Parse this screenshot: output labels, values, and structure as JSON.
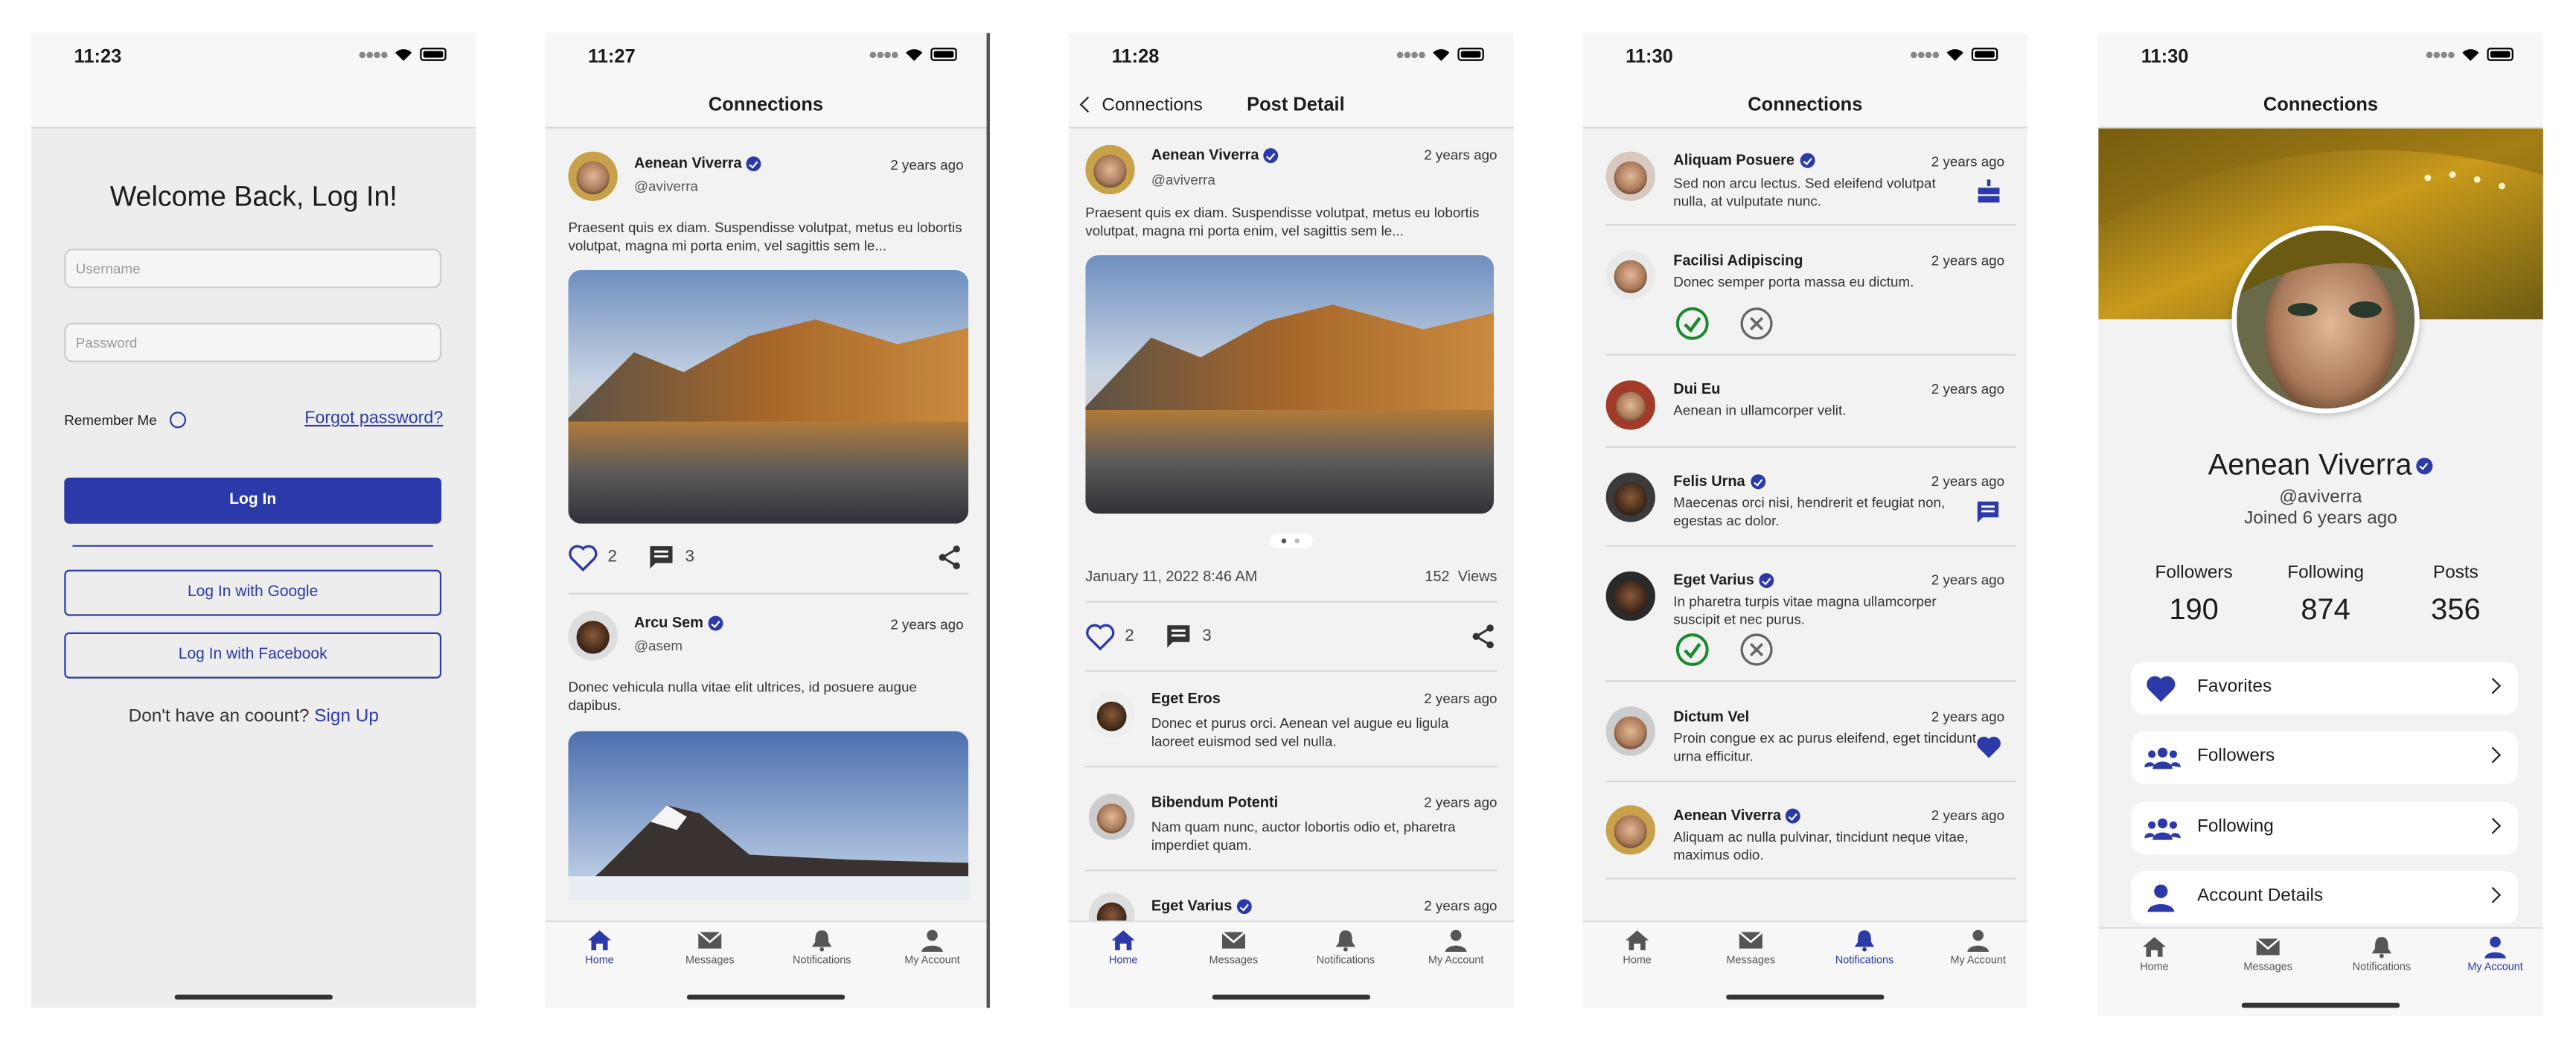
{
  "status_times": [
    "11:23",
    "11:27",
    "11:28",
    "11:30",
    "11:30"
  ],
  "tabs": [
    "Home",
    "Messages",
    "Notifications",
    "My Account"
  ],
  "login": {
    "title": "Welcome Back, Log In!",
    "username_placeholder": "Username",
    "password_placeholder": "Password",
    "remember": "Remember Me",
    "forgot": "Forgot password?",
    "login": "Log In",
    "google": "Log In with Google",
    "facebook": "Log In with Facebook",
    "no_account": "Don't have an coount?",
    "signup": "Sign Up"
  },
  "feed": {
    "title": "Connections",
    "posts": [
      {
        "name": "Aenean Viverra",
        "handle": "@aviverra",
        "time": "2 years ago",
        "text": "Praesent quis ex diam. Suspendisse volutpat, metus eu lobortis volutpat, magna mi porta enim, vel sagittis sem le...",
        "likes": "2",
        "comments": "3"
      },
      {
        "name": "Arcu Sem",
        "handle": "@asem",
        "time": "2 years ago",
        "text": "Donec vehicula nulla vitae elit ultrices, id posuere augue dapibus."
      }
    ]
  },
  "detail": {
    "back": "Connections",
    "title": "Post Detail",
    "name": "Aenean Viverra",
    "handle": "@aviverra",
    "time": "2 years ago",
    "text": "Praesent quis ex diam. Suspendisse volutpat, metus eu lobortis volutpat, magna mi porta enim, vel sagittis sem le...",
    "date": "January 11, 2022 8:46 AM",
    "views_count": "152",
    "views_label": "Views",
    "likes": "2",
    "comments": "3",
    "comment_list": [
      {
        "name": "Eget Eros",
        "time": "2 years ago",
        "text": "Donec et purus orci. Aenean vel augue eu ligula laoreet euismod sed vel nulla."
      },
      {
        "name": "Bibendum Potenti",
        "time": "2 years ago",
        "text": "Nam quam nunc, auctor lobortis odio et, pharetra imperdiet quam."
      },
      {
        "name": "Eget Varius",
        "time": "2 years ago",
        "text": ""
      }
    ]
  },
  "notifications": {
    "title": "Connections",
    "items": [
      {
        "name": "Aliquam Posuere",
        "time": "2 years ago",
        "text": "Sed non arcu lectus. Sed eleifend volutpat nulla, at vulputate nunc.",
        "icon": "cake-icon"
      },
      {
        "name": "Facilisi Adipiscing",
        "time": "2 years ago",
        "text": "Donec semper porta massa eu dictum.",
        "icon": "accept-decline"
      },
      {
        "name": "Dui Eu",
        "time": "2 years ago",
        "text": "Aenean in ullamcorper velit.",
        "icon": ""
      },
      {
        "name": "Felis Urna",
        "time": "2 years ago",
        "text": "Maecenas orci nisi, hendrerit et feugiat non, egestas ac dolor.",
        "icon": "message-icon"
      },
      {
        "name": "Eget Varius",
        "time": "2 years ago",
        "text": "In pharetra turpis vitae magna ullamcorper suscipit et nec purus.",
        "icon": "accept-decline"
      },
      {
        "name": "Dictum Vel",
        "time": "2 years ago",
        "text": "Proin congue ex ac purus eleifend, eget tincidunt urna efficitur.",
        "icon": "heart-icon"
      },
      {
        "name": "Aenean Viverra",
        "time": "2 years ago",
        "text": "Aliquam ac nulla pulvinar, tincidunt neque vitae, maximus odio.",
        "icon": ""
      }
    ]
  },
  "profile": {
    "title": "Connections",
    "name": "Aenean Viverra",
    "handle": "@aviverra",
    "joined": "Joined 6 years ago",
    "stats": [
      {
        "label": "Followers",
        "value": "190"
      },
      {
        "label": "Following",
        "value": "874"
      },
      {
        "label": "Posts",
        "value": "356"
      }
    ],
    "menu": [
      "Favorites",
      "Followers",
      "Following",
      "Account Details"
    ]
  },
  "colors": {
    "accent": "#2c39a8",
    "success": "#1a8a2e"
  }
}
